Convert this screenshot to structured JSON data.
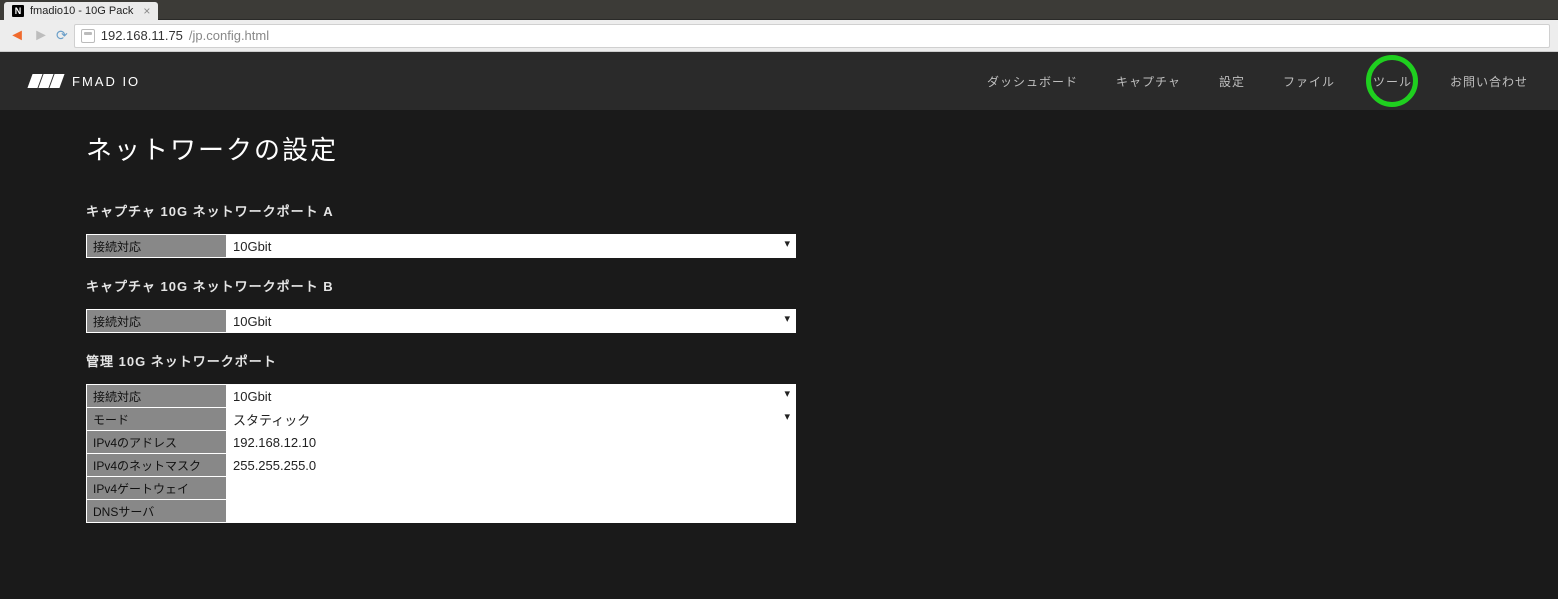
{
  "browser": {
    "tab_title": "fmadio10 - 10G Pack",
    "url_host": "192.168.11.75",
    "url_path": "/jp.config.html"
  },
  "header": {
    "logo_text": "FMAD IO",
    "nav": {
      "dashboard": "ダッシュボード",
      "capture": "キャプチャ",
      "settings": "設定",
      "file": "ファイル",
      "tools": "ツール",
      "contact": "お問い合わせ"
    }
  },
  "page": {
    "title": "ネットワークの設定",
    "port_a": {
      "heading": "キャプチャ 10G ネットワークポート A",
      "link_label": "接続対応",
      "link_value": "10Gbit"
    },
    "port_b": {
      "heading": "キャプチャ 10G ネットワークポート B",
      "link_label": "接続対応",
      "link_value": "10Gbit"
    },
    "mgmt": {
      "heading": "管理 10G ネットワークポート",
      "link_label": "接続対応",
      "link_value": "10Gbit",
      "mode_label": "モード",
      "mode_value": "スタティック",
      "ipv4_addr_label": "IPv4のアドレス",
      "ipv4_addr_value": "192.168.12.10",
      "ipv4_mask_label": "IPv4のネットマスク",
      "ipv4_mask_value": "255.255.255.0",
      "ipv4_gw_label": "IPv4ゲートウェイ",
      "ipv4_gw_value": "",
      "dns_label": "DNSサーバ",
      "dns_value": ""
    }
  }
}
